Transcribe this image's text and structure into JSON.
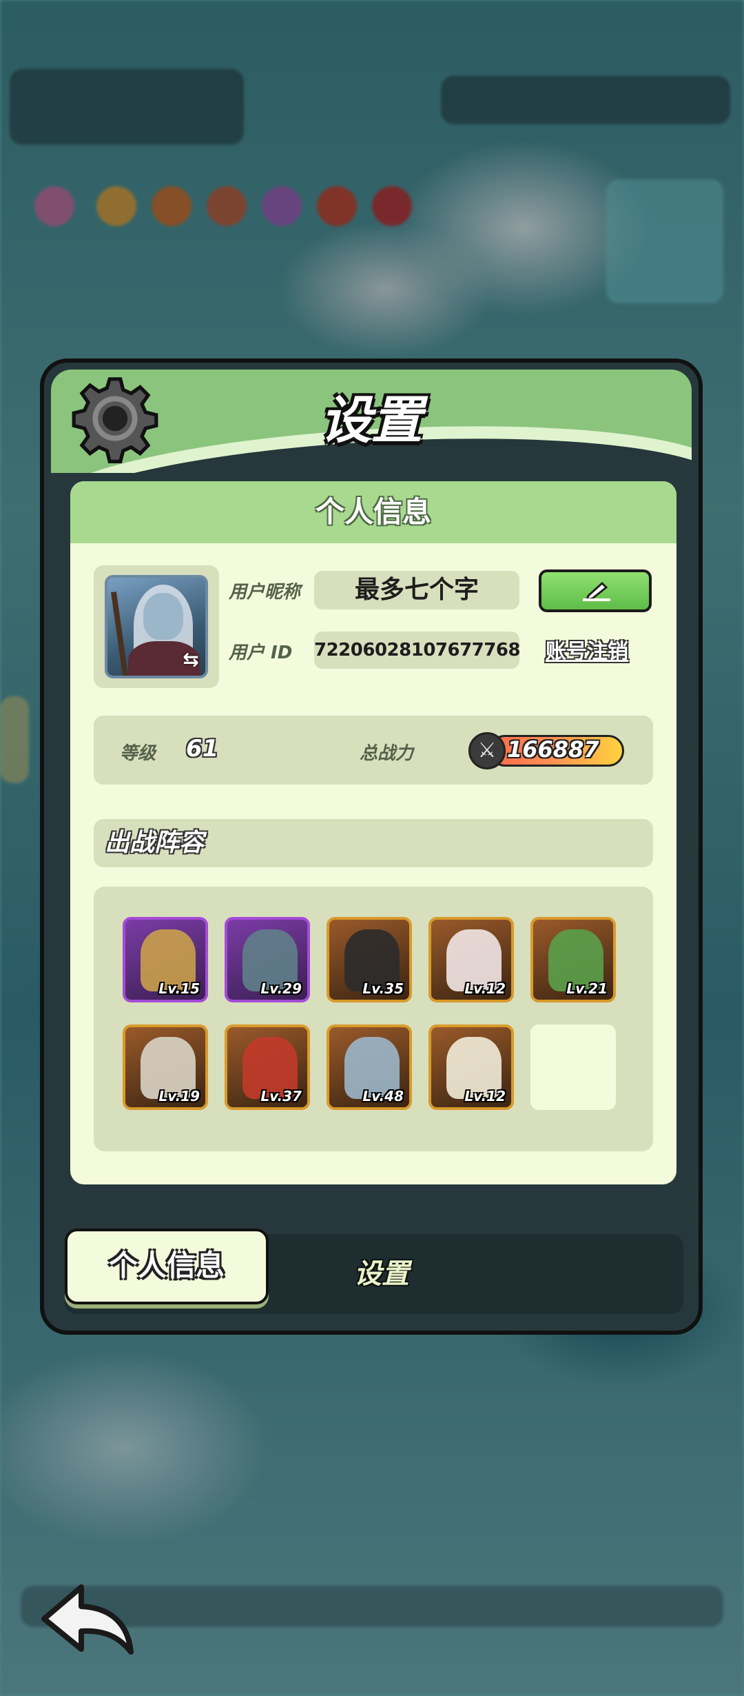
{
  "dialog": {
    "title": "设置"
  },
  "profile_section": {
    "heading": "个人信息"
  },
  "user": {
    "nickname_label": "用户昵称",
    "nickname": "最多七个字",
    "id_label": "用户 ID",
    "id": "72206028107677768",
    "logout_label": "账号注销"
  },
  "stats": {
    "level_label": "等级",
    "level": "61",
    "power_label": "总战力",
    "power": "166887"
  },
  "lineup": {
    "title": "出战阵容",
    "heroes": [
      {
        "level": "Lv.15",
        "rarity": "purple",
        "color": "#c9a04a"
      },
      {
        "level": "Lv.29",
        "rarity": "purple",
        "color": "#5f7f88"
      },
      {
        "level": "Lv.35",
        "rarity": "gold",
        "color": "#2b2b2b"
      },
      {
        "level": "Lv.12",
        "rarity": "gold",
        "color": "#f1e6e6"
      },
      {
        "level": "Lv.21",
        "rarity": "gold",
        "color": "#5aa04a"
      },
      {
        "level": "Lv.19",
        "rarity": "gold",
        "color": "#d9d4c6"
      },
      {
        "level": "Lv.37",
        "rarity": "gold",
        "color": "#c23a2a"
      },
      {
        "level": "Lv.48",
        "rarity": "gold",
        "color": "#9bb6c9"
      },
      {
        "level": "Lv.12",
        "rarity": "gold",
        "color": "#f0ecd8"
      }
    ]
  },
  "tabs": {
    "active": "个人信息",
    "inactive": "设置"
  },
  "colors": {
    "header_green": "#8bc57d",
    "panel_dark": "#26383b",
    "cream": "#f4fbdc",
    "edit_green": "#5fbd48"
  }
}
